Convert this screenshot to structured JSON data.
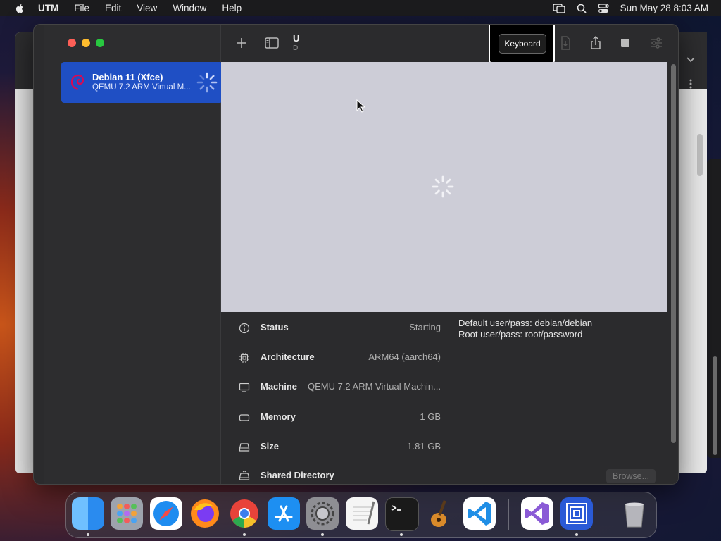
{
  "menubar": {
    "app_name": "UTM",
    "menus": [
      "File",
      "Edit",
      "View",
      "Window",
      "Help"
    ],
    "clock": "Sun May 28  8:03 AM"
  },
  "sidebar": {
    "vm": {
      "name": "Debian 11 (Xfce)",
      "subtitle": "QEMU 7.2 ARM Virtual M...",
      "state_icon": "loading-spinner-icon"
    }
  },
  "toolbar": {
    "title": "U",
    "subtitle": "D",
    "tooltip": "Keyboard",
    "buttons": [
      "add-icon",
      "sidebar-toggle-icon",
      "trash-icon",
      "clone-icon",
      "move-icon",
      "share-icon",
      "stop-icon",
      "settings-icon"
    ]
  },
  "details": {
    "rows": [
      {
        "label": "Status",
        "value": "Starting",
        "icon": "info-icon"
      },
      {
        "label": "Architecture",
        "value": "ARM64 (aarch64)",
        "icon": "cpu-icon"
      },
      {
        "label": "Machine",
        "value": "QEMU 7.2 ARM Virtual Machin...",
        "icon": "display-icon"
      },
      {
        "label": "Memory",
        "value": "1 GB",
        "icon": "memory-icon"
      },
      {
        "label": "Size",
        "value": "1.81 GB",
        "icon": "drive-icon"
      },
      {
        "label": "Shared Directory",
        "value": "",
        "icon": "shared-drive-icon"
      }
    ],
    "notes_line1": "Default user/pass: debian/debian",
    "notes_line2": "Root user/pass: root/password",
    "browse_label": "Browse..."
  },
  "dock": {
    "apps": [
      "Finder",
      "Launchpad",
      "Safari",
      "Firefox",
      "Chrome",
      "App Store",
      "System Settings",
      "TextEdit",
      "Terminal",
      "GarageBand",
      "Visual Studio Code",
      "Visual Studio",
      "UTM",
      "Trash"
    ]
  },
  "colors": {
    "accent": "#1f4fc4",
    "window_bg": "#2b2b2d",
    "screen_bg": "#cdcdd7"
  }
}
